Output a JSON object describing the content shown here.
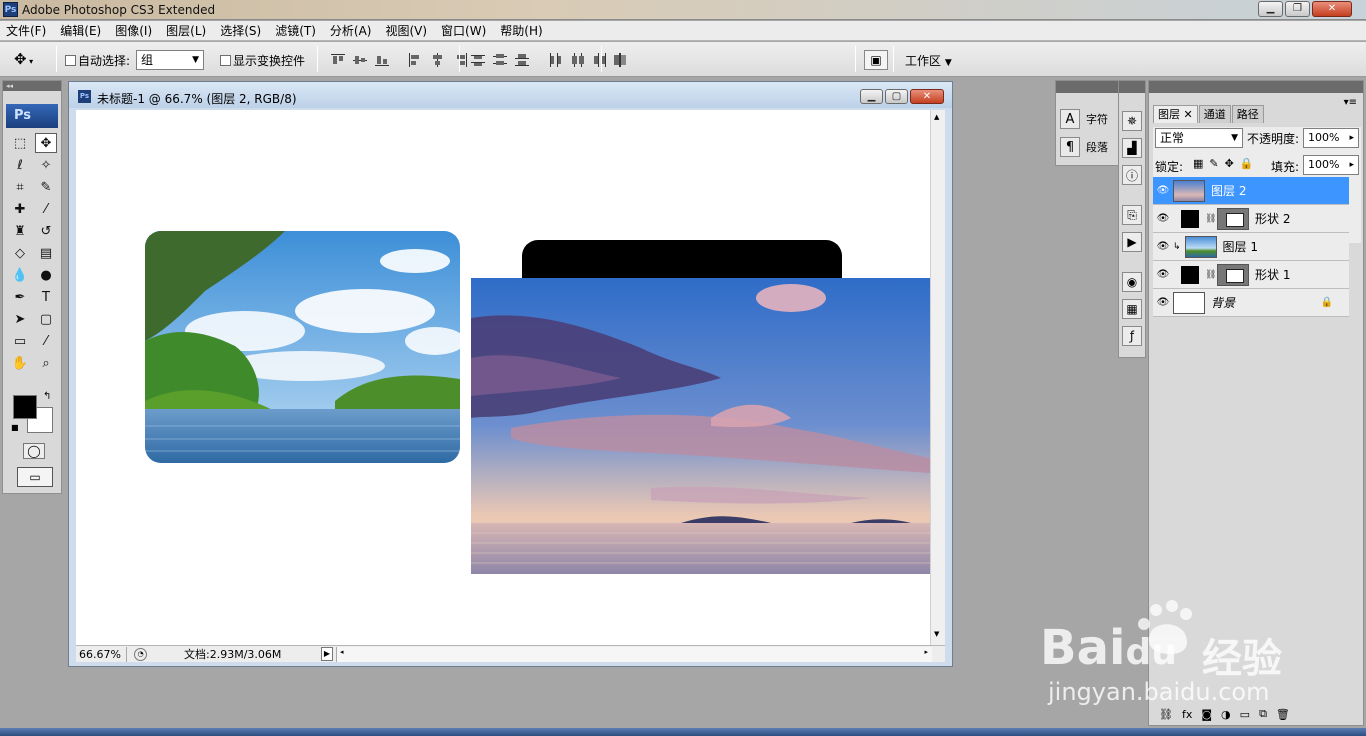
{
  "app": {
    "title": "Adobe Photoshop CS3 Extended",
    "logo": "Ps"
  },
  "menu": [
    "文件(F)",
    "编辑(E)",
    "图像(I)",
    "图层(L)",
    "选择(S)",
    "滤镜(T)",
    "分析(A)",
    "视图(V)",
    "窗口(W)",
    "帮助(H)"
  ],
  "options": {
    "auto_select_label": "自动选择:",
    "auto_select_value": "组",
    "show_transform_label": "显示变换控件",
    "workspace_label": "工作区"
  },
  "document": {
    "title": "未标题-1 @ 66.7% (图层 2, RGB/8)",
    "zoom": "66.67%",
    "doc_size": "文档:2.93M/3.06M"
  },
  "mini_panel": {
    "character": "字符",
    "paragraph": "段落"
  },
  "layers_panel": {
    "tabs": [
      "图层",
      "通道",
      "路径"
    ],
    "blend_mode": "正常",
    "opacity_label": "不透明度:",
    "opacity_value": "100%",
    "lock_label": "锁定:",
    "fill_label": "填充:",
    "fill_value": "100%",
    "layers": [
      {
        "name": "图层 2",
        "selected": true
      },
      {
        "name": "形状 2",
        "selected": false
      },
      {
        "name": "图层 1",
        "selected": false
      },
      {
        "name": "形状 1",
        "selected": false
      },
      {
        "name": "背景",
        "selected": false
      }
    ]
  },
  "watermark": {
    "brand": "Bai",
    "brand_tail": "du",
    "suffix": "经验",
    "url": "jingyan.baidu.com"
  },
  "colors": {
    "selection": "#3d95ff",
    "ui_gray": "#d9d9d9",
    "workspace": "#a6a6a6"
  }
}
